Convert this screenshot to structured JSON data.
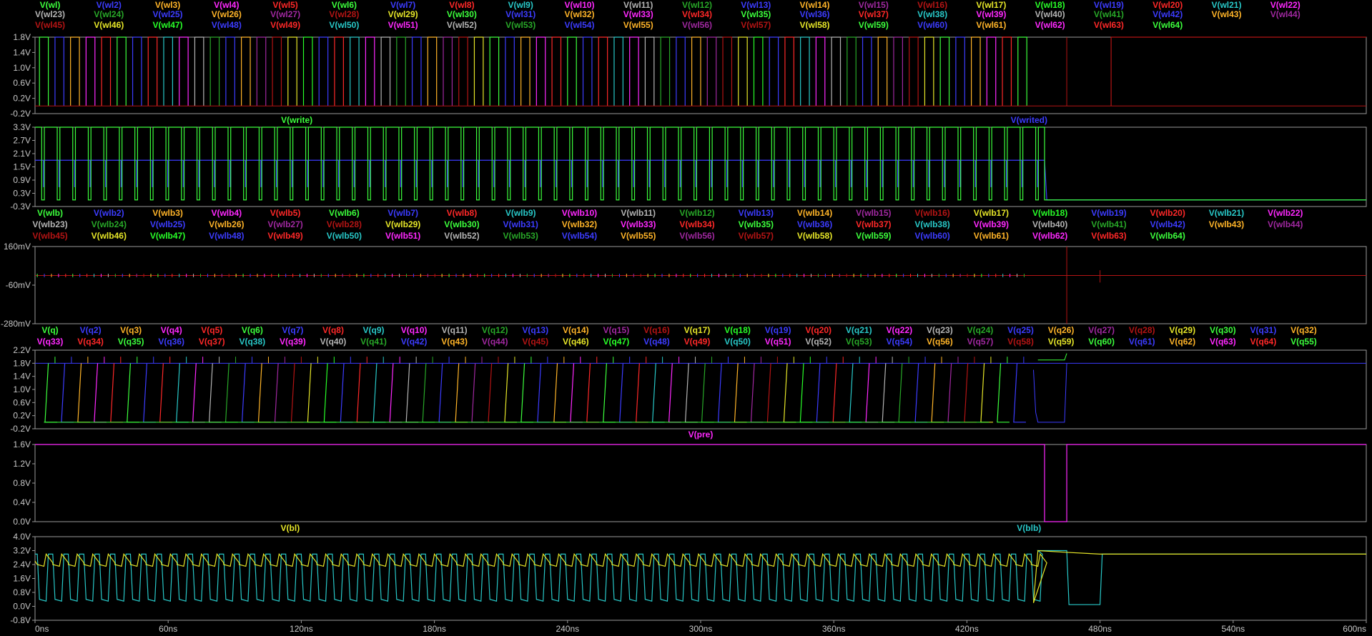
{
  "window": {
    "background": "#000000",
    "frame_color": "#9a9a9a",
    "grid_color": "#9a9a9a",
    "label_color": "#c8c8c8"
  },
  "x_axis": {
    "range_ns": [
      0,
      600
    ],
    "tick_labels": [
      "0ns",
      "60ns",
      "120ns",
      "180ns",
      "240ns",
      "300ns",
      "360ns",
      "420ns",
      "480ns",
      "540ns",
      "600ns"
    ]
  },
  "colors": {
    "green": "#3cff3c",
    "blue": "#3c3cff",
    "orange": "#ffb428",
    "magenta": "#ff28ff",
    "red": "#ff2828",
    "cyan": "#28c8c8",
    "gray": "#b4b4b4",
    "dkgreen": "#28a828",
    "purple": "#a028a0",
    "darkred": "#b41414",
    "yellow": "#e6e628",
    "brightgreen": "#28ff28",
    "pinkmag": "#ff28ff",
    "navy": "#2828ff"
  },
  "palette_cycle": [
    "green",
    "blue",
    "orange",
    "magenta",
    "red",
    "green",
    "blue",
    "red",
    "cyan",
    "magenta",
    "gray",
    "dkgreen",
    "blue",
    "orange",
    "purple",
    "darkred",
    "yellow",
    "brightgreen",
    "blue",
    "red",
    "cyan",
    "pinkmag",
    "gray",
    "dkgreen",
    "blue",
    "orange",
    "purple",
    "darkred",
    "yellow"
  ],
  "panes": [
    {
      "id": "wordlines",
      "legend": [
        "V(wl)",
        "V(wl2)",
        "V(wl3)",
        "V(wl4)",
        "V(wl5)",
        "V(wl6)",
        "V(wl7)",
        "V(wl8)",
        "V(wl9)",
        "V(wl10)",
        "V(wl11)",
        "V(wl12)",
        "V(wl13)",
        "V(wl14)",
        "V(wl15)",
        "V(wl16)",
        "V(wl17)",
        "V(wl18)",
        "V(wl19)",
        "V(wl20)",
        "V(wl21)",
        "V(wl22)",
        "V(wl23)",
        "V(wl24)",
        "V(wl25)",
        "V(wl26)",
        "V(wl27)",
        "V(wl28)",
        "V(wl29)",
        "V(wl30)",
        "V(wl31)",
        "V(wl32)",
        "V(wl33)",
        "V(wl34)",
        "V(wl35)",
        "V(wl36)",
        "V(wl37)",
        "V(wl38)",
        "V(wl39)",
        "V(wl40)",
        "V(wl41)",
        "V(wl42)",
        "V(wl43)",
        "V(wl44)",
        "V(wl45)",
        "V(wl46)",
        "V(wl47)",
        "V(wl48)",
        "V(wl49)",
        "V(wl50)",
        "V(wl51)",
        "V(wl52)",
        "V(wl53)",
        "V(wl54)",
        "V(wl55)",
        "V(wl56)",
        "V(wl57)",
        "V(wl58)",
        "V(wl59)",
        "V(wl60)",
        "V(wl61)",
        "V(wl62)",
        "V(wl63)",
        "V(wl64)"
      ],
      "y_ticks": [
        "1.8V",
        "1.4V",
        "1.0V",
        "0.6V",
        "0.2V",
        "-0.2V"
      ],
      "y_range": [
        -0.2,
        1.8
      ]
    },
    {
      "id": "write",
      "legend": [
        "V(write)",
        "V(writed)"
      ],
      "legend_colors": [
        "green",
        "blue"
      ],
      "y_ticks": [
        "3.3V",
        "2.7V",
        "2.1V",
        "1.5V",
        "0.9V",
        "0.3V",
        "-0.3V"
      ],
      "y_range": [
        -0.3,
        3.3
      ]
    },
    {
      "id": "wordlines_bar",
      "legend": [
        "V(wlb)",
        "V(wlb2)",
        "V(wlb3)",
        "V(wlb4)",
        "V(wlb5)",
        "V(wlb6)",
        "V(wlb7)",
        "V(wlb8)",
        "V(wlb9)",
        "V(wlb10)",
        "V(wlb11)",
        "V(wlb12)",
        "V(wlb13)",
        "V(wlb14)",
        "V(wlb15)",
        "V(wlb16)",
        "V(wlb17)",
        "V(wlb18)",
        "V(wlb19)",
        "V(wlb20)",
        "V(wlb21)",
        "V(wlb22)",
        "V(wlb23)",
        "V(wlb24)",
        "V(wlb25)",
        "V(wlb26)",
        "V(wlb27)",
        "V(wlb28)",
        "V(wlb29)",
        "V(wlb30)",
        "V(wlb31)",
        "V(wlb32)",
        "V(wlb33)",
        "V(wlb34)",
        "V(wlb35)",
        "V(wlb36)",
        "V(wlb37)",
        "V(wlb38)",
        "V(wlb39)",
        "V(wlb40)",
        "V(wlb41)",
        "V(wlb42)",
        "V(wlb43)",
        "V(wlb44)",
        "V(wlb45)",
        "V(wlb46)",
        "V(wlb47)",
        "V(wlb48)",
        "V(wlb49)",
        "V(wlb50)",
        "V(wlb51)",
        "V(wlb52)",
        "V(wlb53)",
        "V(wlb54)",
        "V(wlb55)",
        "V(wlb56)",
        "V(wlb57)",
        "V(wlb58)",
        "V(wlb59)",
        "V(wlb60)",
        "V(wlb61)",
        "V(wlb62)",
        "V(wlb63)",
        "V(wlb64)"
      ],
      "y_ticks": [
        "160mV",
        "-60mV",
        "-280mV"
      ],
      "y_range": [
        -280,
        160
      ]
    },
    {
      "id": "q_nodes",
      "legend": [
        "V(q)",
        "V(q2)",
        "V(q3)",
        "V(q4)",
        "V(q5)",
        "V(q6)",
        "V(q7)",
        "V(q8)",
        "V(q9)",
        "V(q10)",
        "V(q11)",
        "V(q12)",
        "V(q13)",
        "V(q14)",
        "V(q15)",
        "V(q16)",
        "V(q17)",
        "V(q18)",
        "V(q19)",
        "V(q20)",
        "V(q21)",
        "V(q22)",
        "V(q23)",
        "V(q24)",
        "V(q25)",
        "V(q26)",
        "V(q27)",
        "V(q28)",
        "V(q29)",
        "V(q30)",
        "V(q31)",
        "V(q32)",
        "V(q33)",
        "V(q34)",
        "V(q35)",
        "V(q36)",
        "V(q37)",
        "V(q38)",
        "V(q39)",
        "V(q40)",
        "V(q41)",
        "V(q42)",
        "V(q43)",
        "V(q44)",
        "V(q45)",
        "V(q46)",
        "V(q47)",
        "V(q48)",
        "V(q49)",
        "V(q50)",
        "V(q51)",
        "V(q52)",
        "V(q53)",
        "V(q54)",
        "V(q56)",
        "V(q57)",
        "V(q58)",
        "V(q59)",
        "V(q60)",
        "V(q61)",
        "V(q62)",
        "V(q63)",
        "V(q64)",
        "V(q55)"
      ],
      "y_ticks": [
        "2.2V",
        "1.8V",
        "1.4V",
        "1.0V",
        "0.6V",
        "0.2V",
        "-0.2V"
      ],
      "y_range": [
        -0.2,
        2.2
      ]
    },
    {
      "id": "precharge",
      "legend": [
        "V(pre)"
      ],
      "legend_colors": [
        "magenta"
      ],
      "y_ticks": [
        "1.6V",
        "1.2V",
        "0.8V",
        "0.4V",
        "0.0V"
      ],
      "y_range": [
        0.0,
        1.8
      ]
    },
    {
      "id": "bitlines",
      "legend": [
        "V(bl)",
        "V(blb)"
      ],
      "legend_colors": [
        "yellow",
        "cyan"
      ],
      "y_ticks": [
        "4.0V",
        "3.2V",
        "2.4V",
        "1.6V",
        "0.8V",
        "0.0V",
        "-0.8V"
      ],
      "y_range": [
        -0.8,
        4.0
      ]
    }
  ]
}
